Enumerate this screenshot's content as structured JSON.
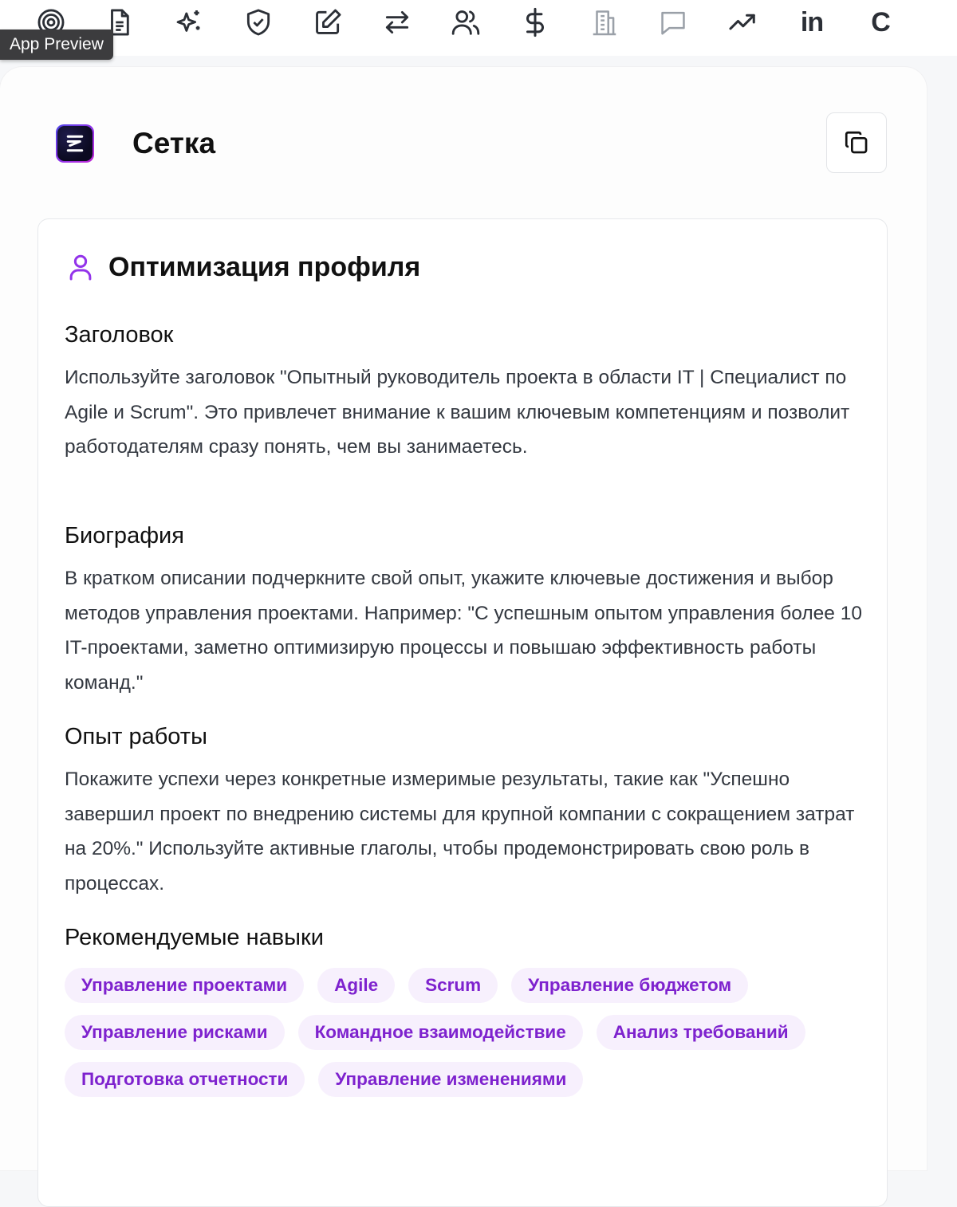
{
  "toolbar": {
    "tools": [
      {
        "name": "target-icon"
      },
      {
        "name": "document-icon"
      },
      {
        "name": "sparkles-icon"
      },
      {
        "name": "shield-check-icon"
      },
      {
        "name": "edit-icon"
      },
      {
        "name": "swap-arrows-icon"
      },
      {
        "name": "users-icon"
      },
      {
        "name": "dollar-icon"
      },
      {
        "name": "building-icon"
      },
      {
        "name": "message-icon"
      },
      {
        "name": "trending-up-icon"
      },
      {
        "name": "linkedin-icon",
        "label": "in"
      },
      {
        "name": "c-letter-icon",
        "label": "C"
      }
    ],
    "tooltip": "App Preview"
  },
  "app": {
    "title": "Сетка",
    "logo_icon": "setka-logo-icon",
    "copy_icon": "copy-icon"
  },
  "card": {
    "title": "Оптимизация профиля",
    "icon": "user-icon",
    "accent_color": "#7e22ce",
    "sections": [
      {
        "title": "Заголовок",
        "text": "Используйте заголовок \"Опытный руководитель проекта в области IT | Специалист по Agile и Scrum\". Это привлечет внимание к вашим ключевым компетенциям и позволит работодателям сразу понять, чем вы занимаетесь."
      },
      {
        "title": "Биография",
        "text": "В кратком описании подчеркните свой опыт, укажите ключевые достижения и выбор методов управления проектами. Например: \"С успешным опытом управления более 10 IT-проектами, заметно оптимизирую процессы и повышаю эффективность работы команд.\""
      },
      {
        "title": "Опыт работы",
        "text": "Покажите успехи через конкретные измеримые результаты, такие как \"Успешно завершил проект по внедрению системы для крупной компании с сокращением затрат на 20%.\" Используйте активные глаголы, чтобы продемонстрировать свою роль в процессах."
      }
    ],
    "skills_title": "Рекомендуемые навыки",
    "skills": [
      "Управление проектами",
      "Agile",
      "Scrum",
      "Управление бюджетом",
      "Управление рисками",
      "Командное взаимодействие",
      "Анализ требований",
      "Подготовка отчетности",
      "Управление изменениями"
    ]
  }
}
